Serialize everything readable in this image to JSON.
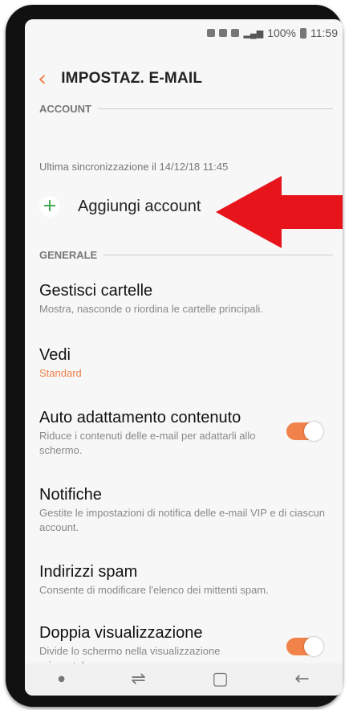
{
  "status": {
    "battery": "100%",
    "time": "11:59"
  },
  "header": {
    "title": "IMPOSTAZ. E-MAIL"
  },
  "sections": {
    "account": "ACCOUNT",
    "general": "GENERALE"
  },
  "account": {
    "last_sync": "Ultima sincronizzazione il 14/12/18  11:45",
    "add_label": "Aggiungi account"
  },
  "items": [
    {
      "title": "Gestisci cartelle",
      "subtitle": "Mostra, nasconde o riordina le cartelle principali."
    },
    {
      "title": "Vedi",
      "subtitle": "Standard"
    },
    {
      "title": "Auto adattamento contenuto",
      "subtitle": "Riduce i contenuti delle e-mail per adattarli allo schermo.",
      "toggle": true
    },
    {
      "title": "Notifiche",
      "subtitle": "Gestite le impostazioni di notifica delle e-mail VIP e di ciascun account."
    },
    {
      "title": "Indirizzi spam",
      "subtitle": "Consente di modificare l'elenco dei mittenti spam."
    },
    {
      "title": "Doppia visualizzazione",
      "subtitle": "Divide lo schermo nella visualizzazione orizzontale",
      "toggle": true
    }
  ],
  "nav": {
    "recent_icon": "recent-apps-icon",
    "home_icon": "home-icon",
    "back_icon": "back-icon"
  },
  "colors": {
    "accent": "#f0824a",
    "arrow": "#e8141c"
  }
}
